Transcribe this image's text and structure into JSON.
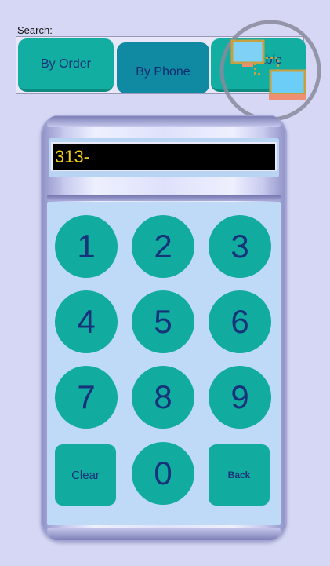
{
  "search": {
    "label": "Search:",
    "tabs": [
      {
        "label": "By Order",
        "selected": false
      },
      {
        "label": "By Phone",
        "selected": true
      },
      {
        "label": "By Table",
        "selected": false
      }
    ]
  },
  "display": {
    "value": "313-"
  },
  "keypad": {
    "keys": [
      "1",
      "2",
      "3",
      "4",
      "5",
      "6",
      "7",
      "8",
      "9",
      "Clear",
      "0",
      "Back"
    ]
  },
  "overlay": {
    "icon": "network-computers-icon"
  },
  "colors": {
    "background": "#d6d7f5",
    "key": "#12ab9f",
    "key_text": "#16327a",
    "tab_selected": "#0f8aa2",
    "display_bg": "#000000",
    "display_text": "#f2cf1c"
  }
}
